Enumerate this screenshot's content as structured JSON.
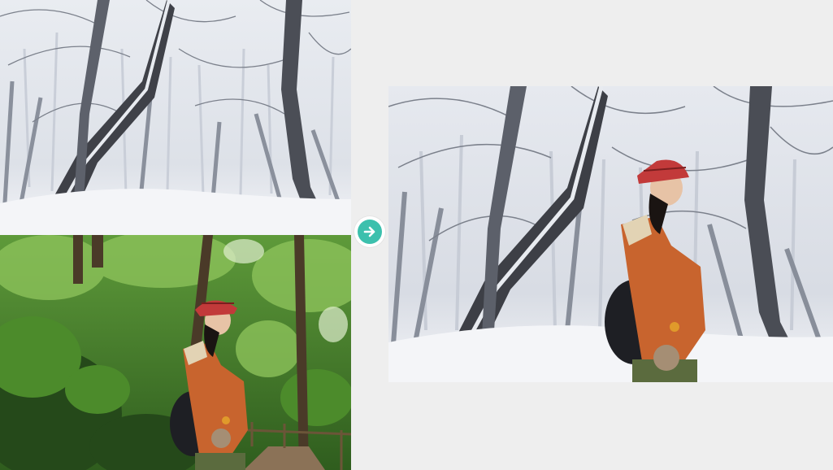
{
  "images": {
    "source_top": "snowy-forest-background",
    "source_bottom": "woman-in-green-forest",
    "result": "woman-composited-in-snowy-forest"
  },
  "arrow": {
    "icon": "arrow-right-icon",
    "color": "#3cc0ad"
  },
  "colors": {
    "page_background": "#eeeeee",
    "snow": "#f2f4f8",
    "foliage": "#3f7d2c",
    "jacket": "#c8642e",
    "hat": "#c23a3a"
  }
}
